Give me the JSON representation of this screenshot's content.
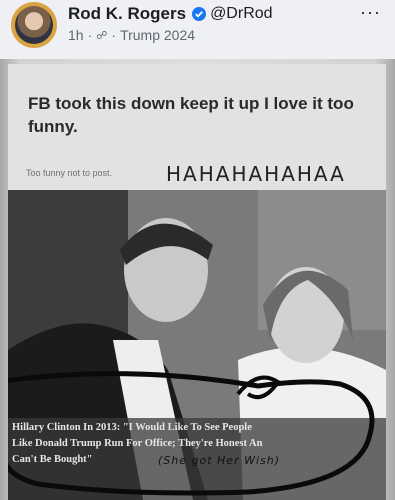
{
  "post": {
    "author": "Rod K. Rogers",
    "handle": "@DrRod",
    "time": "1h",
    "separator": "·",
    "group": "Trump 2024",
    "audience_icon": "group-icon",
    "more_icon": "more-icon",
    "more_label": "···",
    "colors": {
      "verified": "#1877f2",
      "meta_text": "#606770"
    }
  },
  "image": {
    "caption": "FB took this down keep it up I love it too funny.",
    "small_note": "Too funny not to post.",
    "haha_text": "HAHAHAHAHAA",
    "quote_line1": "Hillary Clinton In 2013: \"I Would Like To See People",
    "quote_line2": "Like Donald Trump Run For Office; They're Honest An",
    "quote_line3": "Can't Be Bought\"",
    "handwritten": "(She got Her Wish)"
  }
}
